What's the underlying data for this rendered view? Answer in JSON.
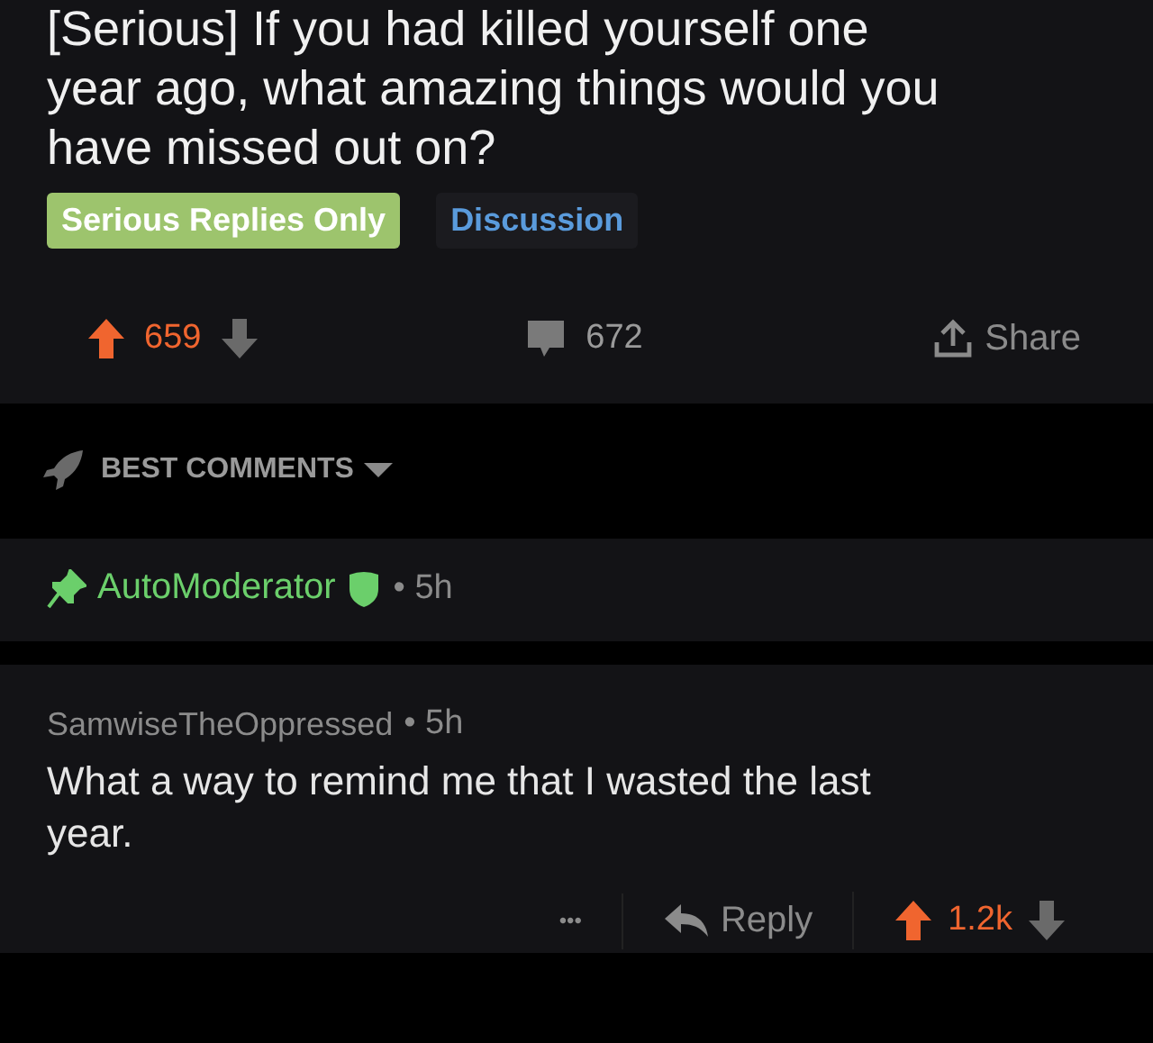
{
  "post": {
    "title": "[Serious] If you had killed yourself one year ago, what amazing things would you have missed out on?",
    "flairs": [
      {
        "label": "Serious Replies Only",
        "kind": "filled",
        "color": "#9dc46d"
      },
      {
        "label": "Discussion",
        "kind": "plain",
        "color": "#5a9bdc"
      }
    ],
    "score": "659",
    "upvoted": true,
    "comments": "672",
    "share": "Share"
  },
  "sort": {
    "label": "BEST COMMENTS"
  },
  "comments": [
    {
      "author": "AutoModerator",
      "kind": "moderator",
      "pinned": true,
      "time": "• 5h"
    },
    {
      "author": "SamwiseTheOppressed",
      "kind": "user",
      "pinned": false,
      "time": "• 5h",
      "body": "What a way to remind me that I wasted the last year.",
      "more": "•••",
      "reply": "Reply",
      "score": "1.2k",
      "upvoted": true
    }
  ]
}
